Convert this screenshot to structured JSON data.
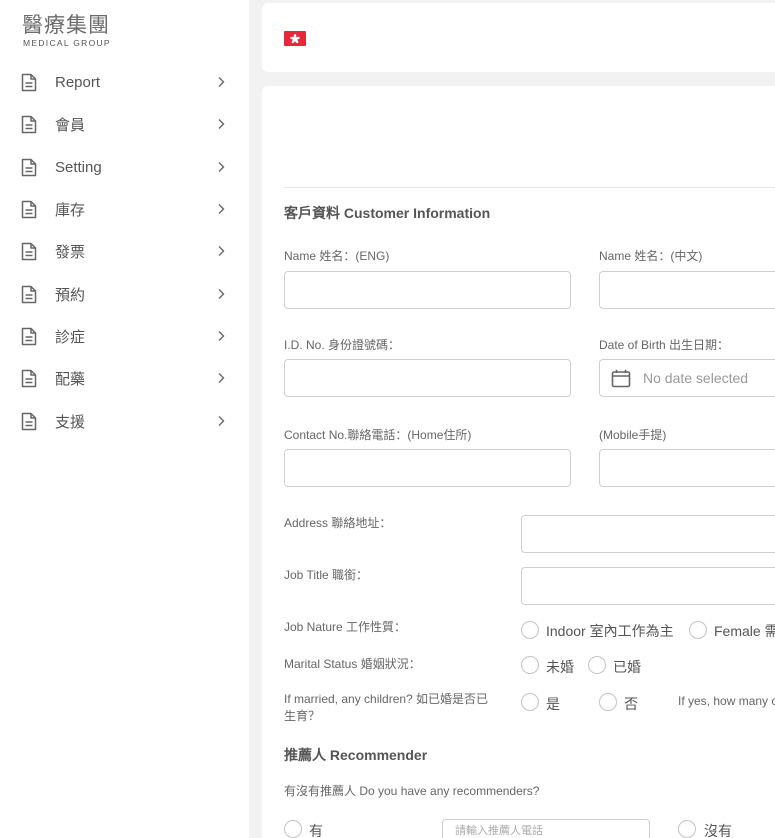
{
  "sidebar": {
    "logo_cn": "醫療集團",
    "logo_en": "MEDICAL GROUP",
    "items": [
      {
        "label": "Report"
      },
      {
        "label": "會員"
      },
      {
        "label": "Setting"
      },
      {
        "label": "庫存"
      },
      {
        "label": "發票"
      },
      {
        "label": "預約"
      },
      {
        "label": "診症"
      },
      {
        "label": "配藥"
      },
      {
        "label": "支援"
      }
    ]
  },
  "header": {
    "flag_icon": "hong-kong-flag-icon",
    "flag_color": "#e8283a"
  },
  "form": {
    "customer_section_title": "客戶資料 Customer Information",
    "name_eng_label": "Name 姓名：(ENG)",
    "name_chi_label": "Name 姓名：(中文)",
    "id_label": "I.D. No. 身份證號碼：",
    "dob_label": "Date of Birth 出生日期：",
    "dob_placeholder": "No date selected",
    "contact_home_label": "Contact No.聯絡電話：(Home住所)",
    "contact_mobile_label": "(Mobile手提)",
    "address_label": "Address 聯絡地址：",
    "job_title_label": "Job Title 職銜：",
    "job_nature_label": "Job Nature 工作性質：",
    "job_nature_options": [
      "Indoor 室內工作為主",
      "Female 需"
    ],
    "marital_label": "Marital Status 婚姻狀況：",
    "marital_options": [
      "未婚",
      "已婚"
    ],
    "children_label_1": "If married, any children? 如已婚是否已",
    "children_label_2": "生育？",
    "children_options": [
      "是",
      "否"
    ],
    "children_howmany": "If yes, how many c",
    "recommender_section_title": "推薦人 Recommender",
    "recommender_question": "有沒有推薦人 Do you have any recommenders?",
    "recommender_yes": "有",
    "recommender_no": "沒有",
    "recommender_phone_placeholder": "請輸入推薦人電話"
  }
}
